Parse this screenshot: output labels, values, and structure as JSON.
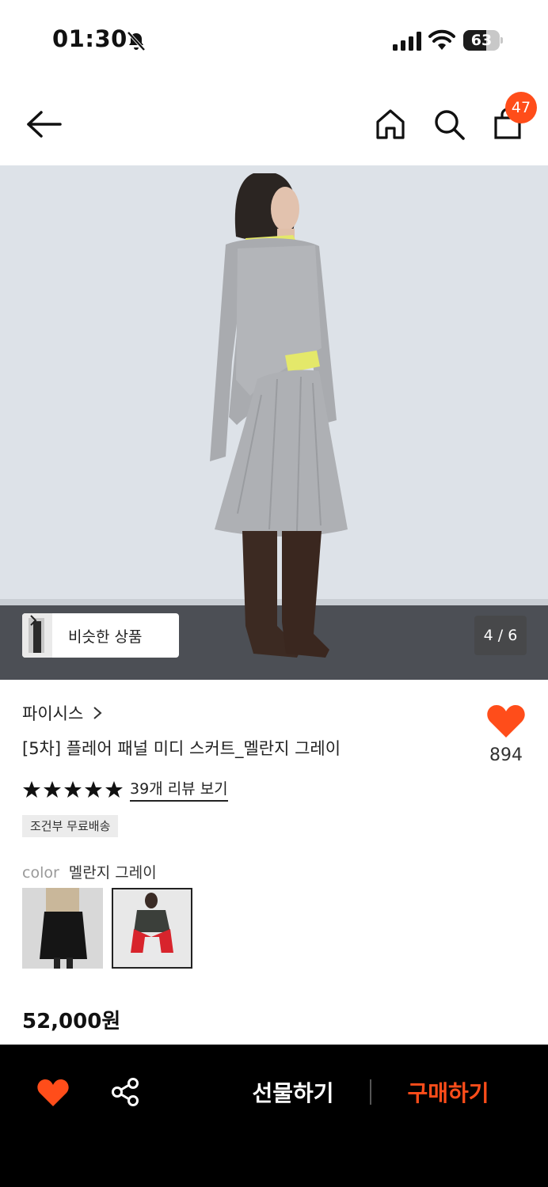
{
  "status_bar": {
    "time": "01:30",
    "battery": "63",
    "battery_level": 0.63,
    "icons": [
      "bell-off-icon",
      "signal-icon",
      "wifi-icon",
      "battery-icon"
    ]
  },
  "header": {
    "icons": [
      "back-arrow-icon",
      "home-icon",
      "search-icon",
      "shopping-bag-icon"
    ],
    "cart_badge": "47"
  },
  "hero": {
    "similar_label": "비슷한 상품",
    "page_counter": "4 / 6"
  },
  "product": {
    "brand": "파이시스",
    "title": "[5차] 플레어 패널 미디 스커트_멜란지 그레이",
    "like_count": "894",
    "rating_stars": 5,
    "review_link": "39개 리뷰 보기",
    "shipping_badge": "조건부 무료배송",
    "color_label": "color",
    "color_value": "멜란지 그레이",
    "price": "52,000원"
  },
  "bottom_bar": {
    "gift_label": "선물하기",
    "buy_label": "구매하기"
  },
  "colors": {
    "accent": "#ff4d1a",
    "bottom_bar_bg": "#000000"
  }
}
